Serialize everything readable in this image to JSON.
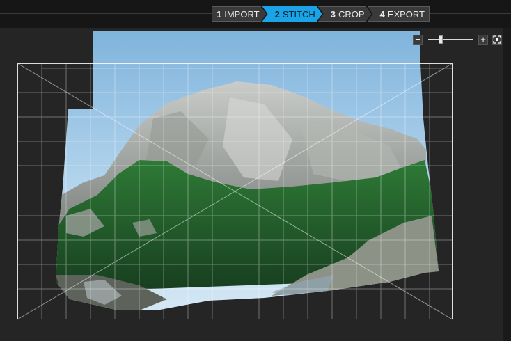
{
  "steps": [
    {
      "num": "1",
      "label": "IMPORT",
      "active": false
    },
    {
      "num": "2",
      "label": "STITCH",
      "active": true
    },
    {
      "num": "3",
      "label": "CROP",
      "active": false
    },
    {
      "num": "4",
      "label": "EXPORT",
      "active": false
    }
  ],
  "zoom": {
    "minus_label": "−",
    "plus_label": "+",
    "fit_icon": "fit-screen-icon",
    "level": 0.25
  },
  "colors": {
    "accent": "#1aa3e6",
    "background": "#1e1e1e",
    "canvas": "#252525",
    "overlay_lines": "#ffffff"
  },
  "icons": [
    "minus-icon",
    "plus-icon",
    "fit-screen-icon"
  ]
}
